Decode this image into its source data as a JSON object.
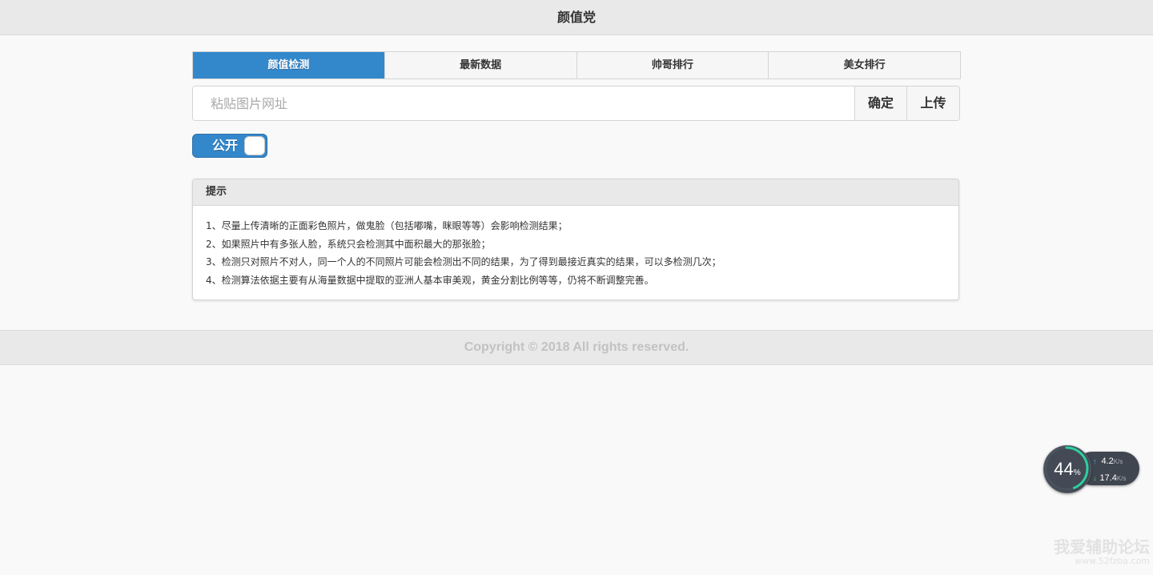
{
  "header": {
    "title": "颜值党"
  },
  "tabs": [
    {
      "label": "颜值检测",
      "active": true
    },
    {
      "label": "最新数据",
      "active": false
    },
    {
      "label": "帅哥排行",
      "active": false
    },
    {
      "label": "美女排行",
      "active": false
    }
  ],
  "url_form": {
    "placeholder": "粘贴图片网址",
    "value": "",
    "confirm_label": "确定",
    "upload_label": "上传"
  },
  "toggle": {
    "label": "公开",
    "on": true
  },
  "tips": {
    "title": "提示",
    "lines": [
      "1、尽量上传清晰的正面彩色照片，做鬼脸（包括嘟嘴，眯眼等等）会影响检测结果；",
      "2、如果照片中有多张人脸，系统只会检测其中面积最大的那张脸；",
      "3、检测只对照片不对人，同一个人的不同照片可能会检测出不同的结果，为了得到最接近真实的结果，可以多检测几次；",
      "4、检测算法依据主要有从海量数据中提取的亚洲人基本审美观，黄金分割比例等等，仍将不断调整完善。"
    ]
  },
  "footer": {
    "copyright": "Copyright © 2018 All rights reserved."
  },
  "net_widget": {
    "percent": "44",
    "percent_unit": "%",
    "upload_speed": "4.2",
    "download_speed": "17.4",
    "speed_unit": "K/s"
  },
  "watermark": {
    "text": "我爱辅助论坛",
    "url": "www.52fzba.com"
  },
  "colors": {
    "accent": "#3388cc",
    "header_bg": "#e9e9e9",
    "page_bg": "#f9f9f9"
  }
}
